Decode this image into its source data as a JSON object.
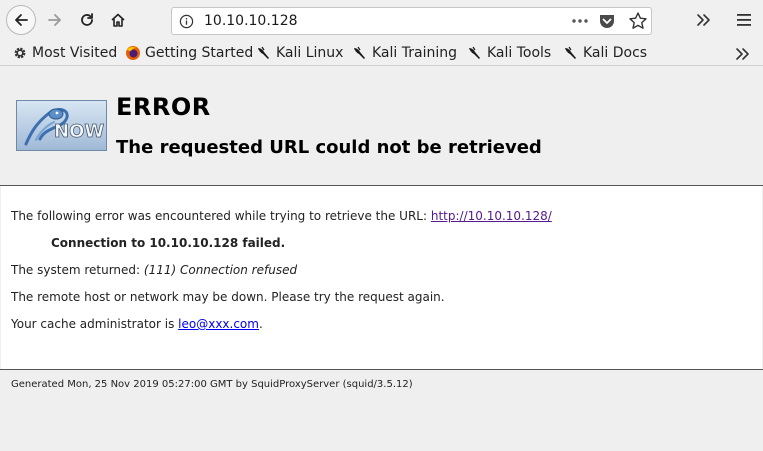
{
  "browser": {
    "url": "10.10.10.128",
    "bookmarks": [
      {
        "label": "Most Visited",
        "icon": "gear-icon"
      },
      {
        "label": "Getting Started",
        "icon": "firefox-icon"
      },
      {
        "label": "Kali Linux",
        "icon": "kali-dragon-icon"
      },
      {
        "label": "Kali Training",
        "icon": "kali-dragon-icon"
      },
      {
        "label": "Kali Tools",
        "icon": "kali-dragon-icon"
      },
      {
        "label": "Kali Docs",
        "icon": "kali-dragon-icon"
      }
    ]
  },
  "page": {
    "heading": "ERROR",
    "subheading": "The requested URL could not be retrieved",
    "intro_text": "The following error was encountered while trying to retrieve the URL: ",
    "error_url": "http://10.10.10.128/",
    "error_detail": "Connection to 10.10.10.128 failed.",
    "system_returned_label": "The system returned: ",
    "system_returned_value": "(111) Connection refused",
    "remote_host_text": "The remote host or network may be down. Please try the request again.",
    "admin_text": "Your cache administrator is ",
    "admin_email": "leo@xxx.com",
    "admin_suffix": ".",
    "footer": "Generated Mon, 25 Nov 2019 05:27:00 GMT by SquidProxyServer (squid/3.5.12)"
  },
  "colors": {
    "link": "#0000ee",
    "visited_link": "#551a8b",
    "logo_blue": "#5a8fc9"
  }
}
